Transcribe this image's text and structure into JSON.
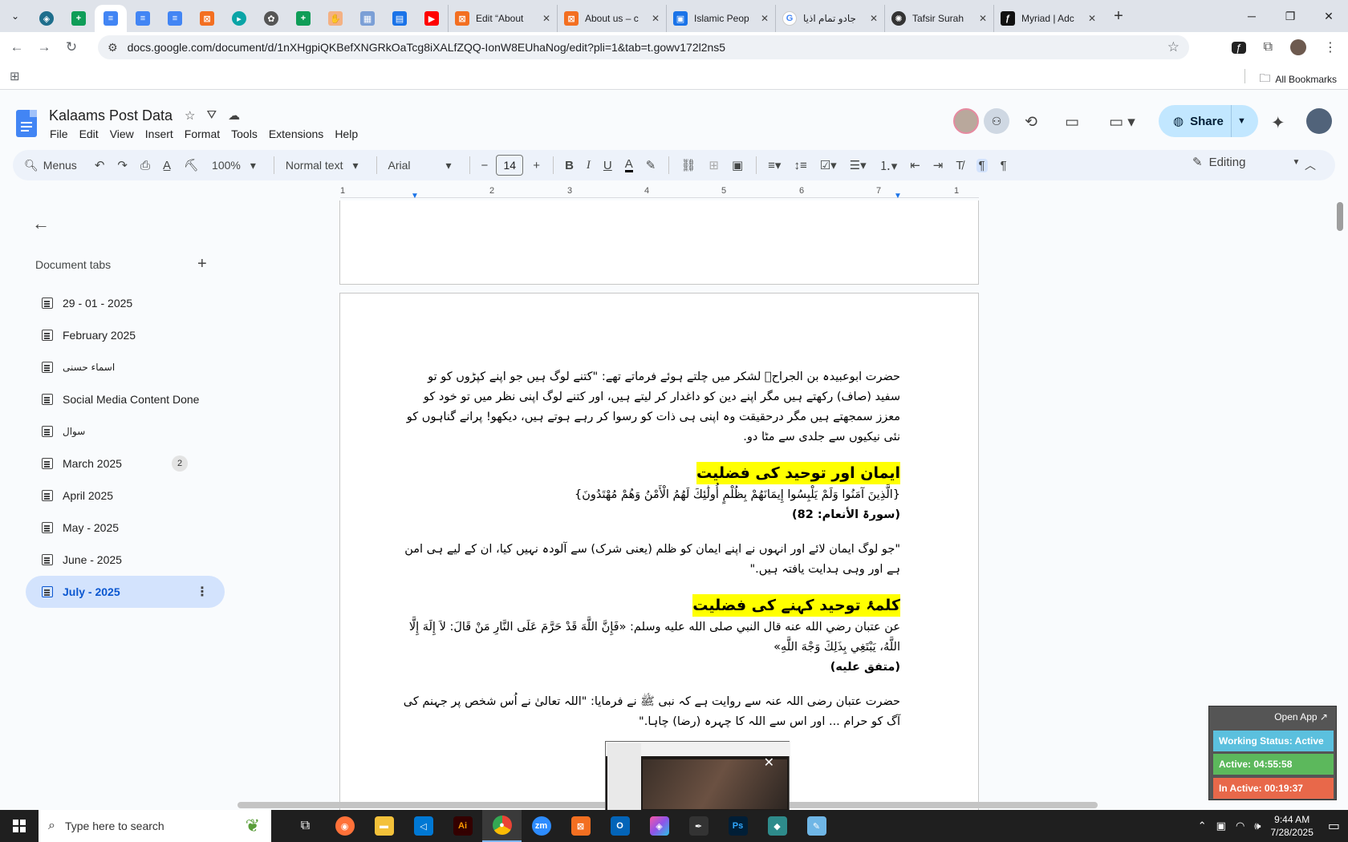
{
  "browser": {
    "tabs": [
      {
        "title": "Edit “About",
        "icon": "orange-box-icon",
        "color": "#f36f21"
      },
      {
        "title": "About us – c",
        "icon": "orange-box-icon",
        "color": "#f36f21"
      },
      {
        "title": "Islamic Peop",
        "icon": "blue-square-icon",
        "color": "#1a73e8"
      },
      {
        "title": "جادو تمام اذیا",
        "icon": "google-g-icon",
        "color": "#4285f4"
      },
      {
        "title": "Tafsir Surah",
        "icon": "dark-circle-icon",
        "color": "#333333"
      },
      {
        "title": "Myriad | Adc",
        "icon": "myriad-icon",
        "color": "#111111"
      }
    ],
    "url": "docs.google.com/document/d/1nXHgpiQKBefXNGRkOaTcg8iXALfZQQ-IonW8EUhaNog/edit?pli=1&tab=t.gowv172l2ns5",
    "bookmarks_label": "All Bookmarks"
  },
  "doc": {
    "title": "Kalaams Post Data",
    "menu": [
      "File",
      "Edit",
      "View",
      "Insert",
      "Format",
      "Tools",
      "Extensions",
      "Help"
    ],
    "share_label": "Share"
  },
  "toolbar": {
    "menus_label": "Menus",
    "zoom": "100%",
    "style": "Normal text",
    "font": "Arial",
    "font_size": "14",
    "mode": "Editing"
  },
  "ruler": [
    "1",
    "1",
    "2",
    "3",
    "4",
    "5",
    "6",
    "7"
  ],
  "sidebar": {
    "heading": "Document tabs",
    "tabs": [
      {
        "label": "29 - 01 - 2025"
      },
      {
        "label": "February 2025"
      },
      {
        "label": "اسماء حسنی"
      },
      {
        "label": "Social Media Content Done"
      },
      {
        "label": "سوال"
      },
      {
        "label": "March 2025",
        "badge": "2"
      },
      {
        "label": "April 2025"
      },
      {
        "label": "May - 2025"
      },
      {
        "label": "June - 2025"
      },
      {
        "label": "July - 2025",
        "active": true
      }
    ]
  },
  "content": {
    "p1": "حضرت ابوعبیدہ بن الجراحؓ لشکر میں چلتے ہوئے فرماتے تھے: \"کتنے لوگ ہیں جو اپنے کپڑوں کو تو سفید (صاف) رکھتے ہیں مگر اپنے دین کو داغدار کر لیتے ہیں، اور کتنے لوگ اپنی نظر میں تو خود کو معزز سمجھتے ہیں مگر درحقیقت وہ اپنی ہی ذات کو رسوا کر رہے ہوتے ہیں، دیکھو! پرانے گناہوں کو نئی نیکیوں سے جلدی سے مٹا دو.",
    "h1": "ایمان اور توحید کی فضلیت",
    "ayah": "{الَّذِينَ آمَنُوا وَلَمْ يَلْبِسُوا إِيمَانَهُمْ بِظُلْمٍ أُولَٰئِكَ لَهُمُ الْأَمْنُ وَهُمْ مُهْتَدُونَ}",
    "ayah_ref": "(سورۃ الأنعام: 82)",
    "p2": "\"جو لوگ ایمان لائے اور انہوں نے اپنے ایمان کو ظلم (یعنی شرک) سے آلودہ نہیں کیا، ان کے لیے ہی امن ہے اور وہی ہدایت یافتہ ہیں.\"",
    "h2": "کلمۂ توحید کہنے کی فضلیت",
    "hadith": "عن عتبان رضي الله عنه قال النبي صلى الله عليه وسلم: «فَإِنَّ اللَّهَ قَدْ حَرَّمَ عَلَى النَّارِ مَنْ قَالَ: لاَ إِلَهَ إِلَّا اللَّهُ، يَبْتَغِي بِذَلِكَ وَجْهَ اللَّهِ»",
    "hadith_ref": "(متفق علیه)",
    "p3": "حضرت عتبان رضی اللہ عنہ سے روایت ہے کہ نبی ﷺ نے فرمایا: \"اللہ تعالیٰ نے اُس شخص پر جہنم کی آگ کو حرام ... اور اس سے اللہ کا چہرہ (رضا) چاہا.\""
  },
  "tracker": {
    "open_label": "Open App ↗",
    "status": "Working Status: Active",
    "active": "Active: 04:55:58",
    "inactive": "In Active: 00:19:37"
  },
  "taskbar": {
    "search_placeholder": "Type here to search",
    "time": "9:44 AM",
    "date": "7/28/2025"
  }
}
